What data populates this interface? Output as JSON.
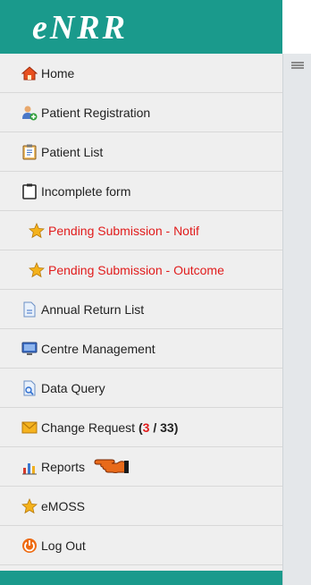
{
  "app": {
    "logo": "eNRR"
  },
  "menu": {
    "home": "Home",
    "patient_registration": "Patient Registration",
    "patient_list": "Patient List",
    "incomplete_form": "Incomplete form",
    "pending_notif": "Pending Submission - Notif",
    "pending_outcome": "Pending Submission - Outcome",
    "annual_return": "Annual Return List",
    "centre_management": "Centre Management",
    "data_query": "Data Query",
    "change_request": "Change Request",
    "change_request_open": "(",
    "change_request_new": "3",
    "change_request_sep": " / ",
    "change_request_total": "33",
    "change_request_close": ")",
    "reports": "Reports",
    "emoss": "eMOSS",
    "logout": "Log Out"
  },
  "colors": {
    "brand": "#1a9a8c",
    "alert": "#e11c1c"
  }
}
